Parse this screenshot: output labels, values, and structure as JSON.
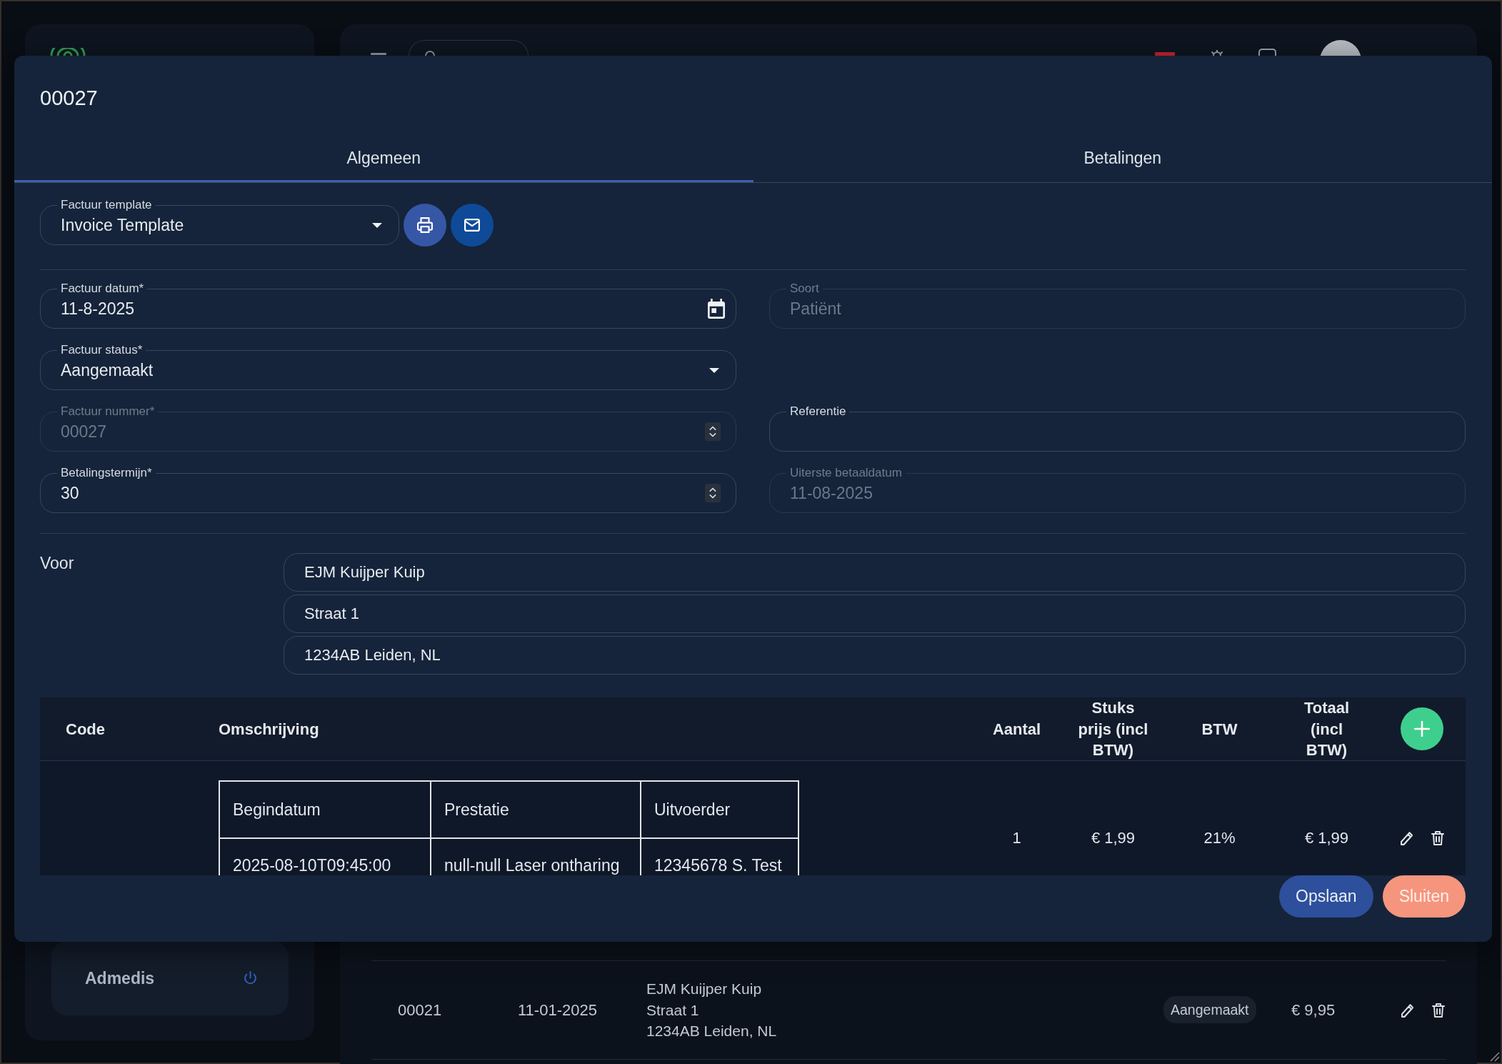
{
  "background": {
    "sidebar": {
      "account": {
        "label": "Admedis"
      }
    },
    "invoices": [
      {
        "number": "00021",
        "date": "11-01-2025",
        "customer": [
          "EJM Kuijper Kuip",
          "Straat 1",
          "1234AB Leiden, NL"
        ],
        "status": "Aangemaakt",
        "amount": "€ 9,95"
      }
    ]
  },
  "dialog": {
    "title": "00027",
    "tabs": [
      {
        "label": "Algemeen",
        "selected": true
      },
      {
        "label": "Betalingen",
        "selected": false
      }
    ],
    "template": {
      "kind": "select",
      "label": "Factuur template",
      "value": "Invoice Template",
      "disabled": false
    },
    "field_rows": [
      [
        {
          "kind": "date",
          "label": "Factuur datum*",
          "value": "11-8-2025",
          "disabled": false
        },
        {
          "kind": "text",
          "label": "Soort",
          "value": "Patiënt",
          "disabled": true
        }
      ],
      [
        {
          "kind": "select",
          "label": "Factuur status*",
          "value": "Aangemaakt",
          "disabled": false
        }
      ],
      [
        {
          "kind": "number",
          "label": "Factuur nummer*",
          "value": "00027",
          "disabled": true
        },
        {
          "kind": "text",
          "label": "Referentie",
          "disabled": false
        }
      ],
      [
        {
          "kind": "number",
          "label": "Betalingstermijn*",
          "value": "30",
          "disabled": false
        },
        {
          "kind": "text",
          "label": "Uiterste betaaldatum",
          "value": "11-08-2025",
          "disabled": true
        }
      ]
    ],
    "recipient": {
      "label": "Voor",
      "lines": [
        "EJM Kuijper Kuip",
        "Straat 1",
        "1234AB Leiden, NL"
      ]
    },
    "lines_table": {
      "columns": [
        "Code",
        "Omschrijving",
        "Aantal",
        "Stuks prijs (incl BTW)",
        "BTW",
        "Totaal (incl BTW)"
      ],
      "rows": [
        {
          "details": {
            "columns": [
              "Begindatum",
              "Prestatie",
              "Uitvoerder"
            ],
            "rows": [
              [
                "2025-08-10T09:45:00",
                "null-null Laser ontharing",
                "12345678 S. Test"
              ]
            ]
          },
          "quantity": "1",
          "unit_price": "€ 1,99",
          "vat": "21%",
          "total": "€ 1,99"
        }
      ]
    },
    "buttons": [
      {
        "label": "Opslaan",
        "kind": "save"
      },
      {
        "label": "Sluiten",
        "kind": "close"
      }
    ]
  }
}
